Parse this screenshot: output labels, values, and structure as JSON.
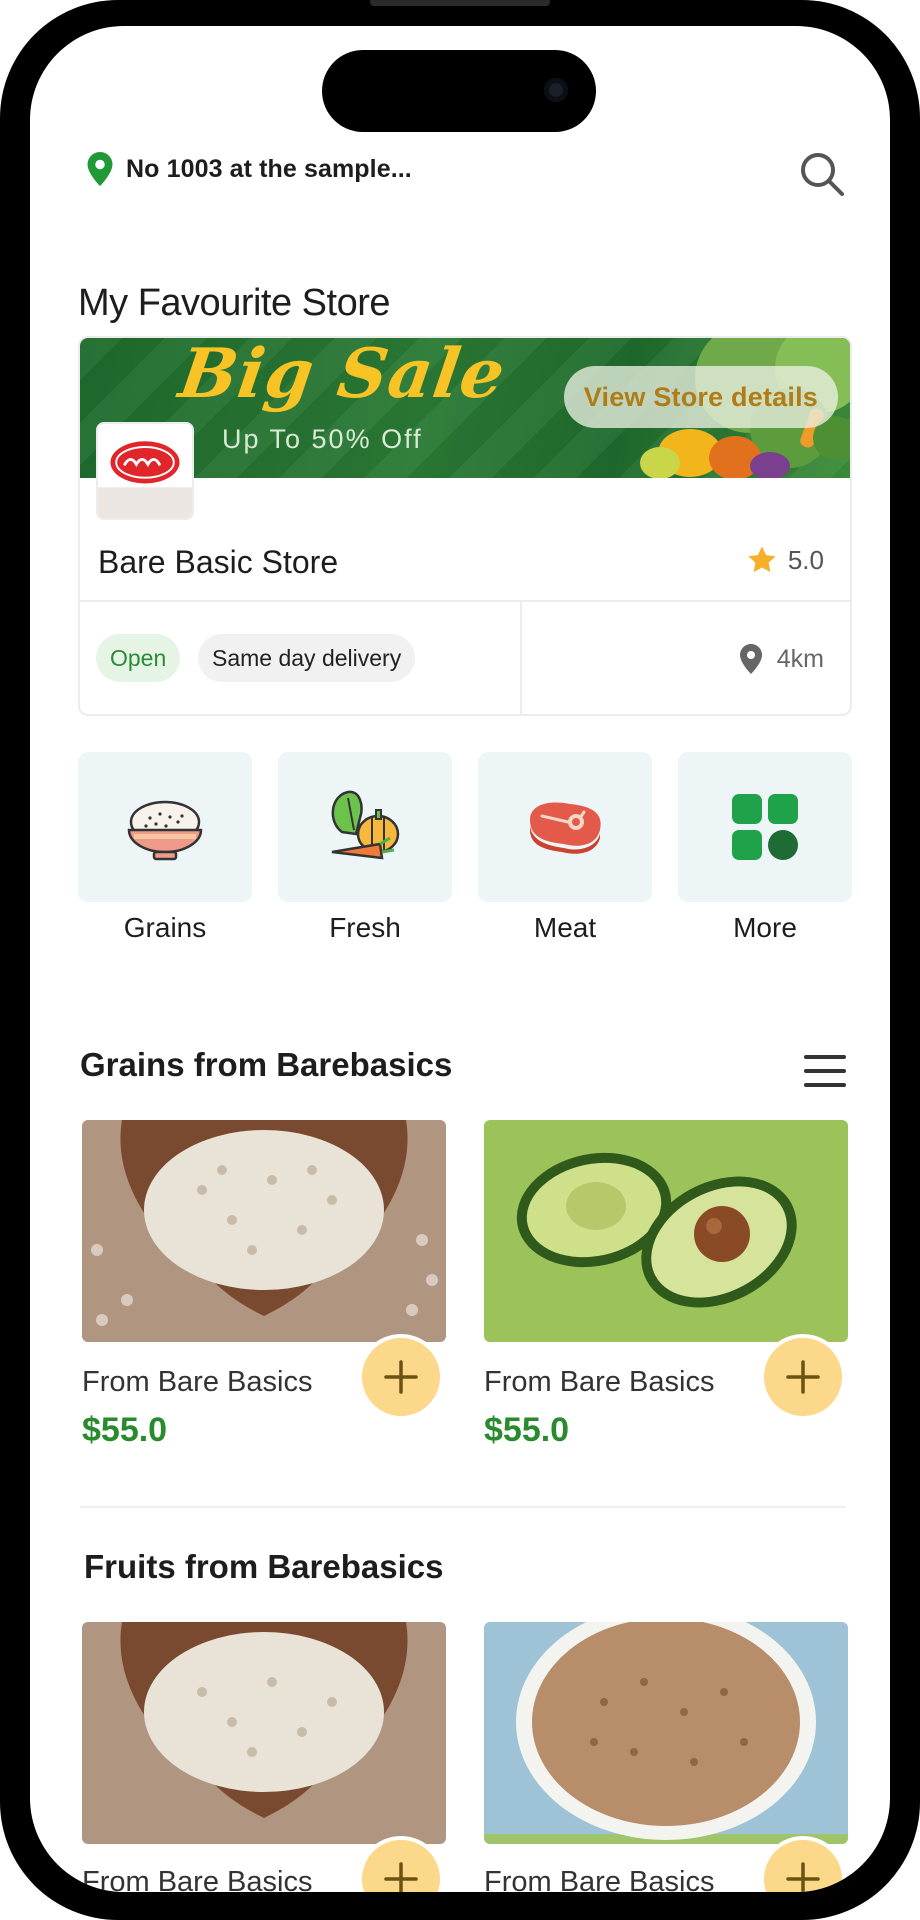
{
  "header": {
    "location_text": "No 1003 at the sample...",
    "location_icon": "map-pin-icon",
    "search_icon": "search-icon"
  },
  "favourite_store": {
    "section_title": "My Favourite Store",
    "banner": {
      "headline": "Big Sale",
      "subline": "Up To 50% Off",
      "cta_label": "View Store details"
    },
    "store_name": "Bare Basic Store",
    "rating": "5.0",
    "status_chip": "Open",
    "delivery_chip": "Same day delivery",
    "distance": "4km"
  },
  "categories": [
    {
      "label": "Grains",
      "icon": "rice-bowl-icon"
    },
    {
      "label": "Fresh",
      "icon": "vegetables-icon"
    },
    {
      "label": "Meat",
      "icon": "steak-icon"
    },
    {
      "label": "More",
      "icon": "grid-icon"
    }
  ],
  "sections": [
    {
      "title": "Grains from Barebasics",
      "products": [
        {
          "from": "From Bare Basics",
          "price": "$55.0",
          "image": "beans-in-hands"
        },
        {
          "from": "From Bare Basics",
          "price": "$55.0",
          "image": "avocado"
        }
      ]
    },
    {
      "title": "Fruits from Barebasics",
      "products": [
        {
          "from": "From Bare Basics",
          "price": "",
          "image": "beans-in-hands"
        },
        {
          "from": "From Bare Basics",
          "price": "",
          "image": "grains-bowl"
        }
      ]
    }
  ],
  "colors": {
    "brand_green": "#2a8a2e",
    "add_button": "#fbd88a",
    "category_bg": "#eef5f7",
    "banner_green": "#1f6b2e",
    "banner_yellow": "#f7c325"
  }
}
